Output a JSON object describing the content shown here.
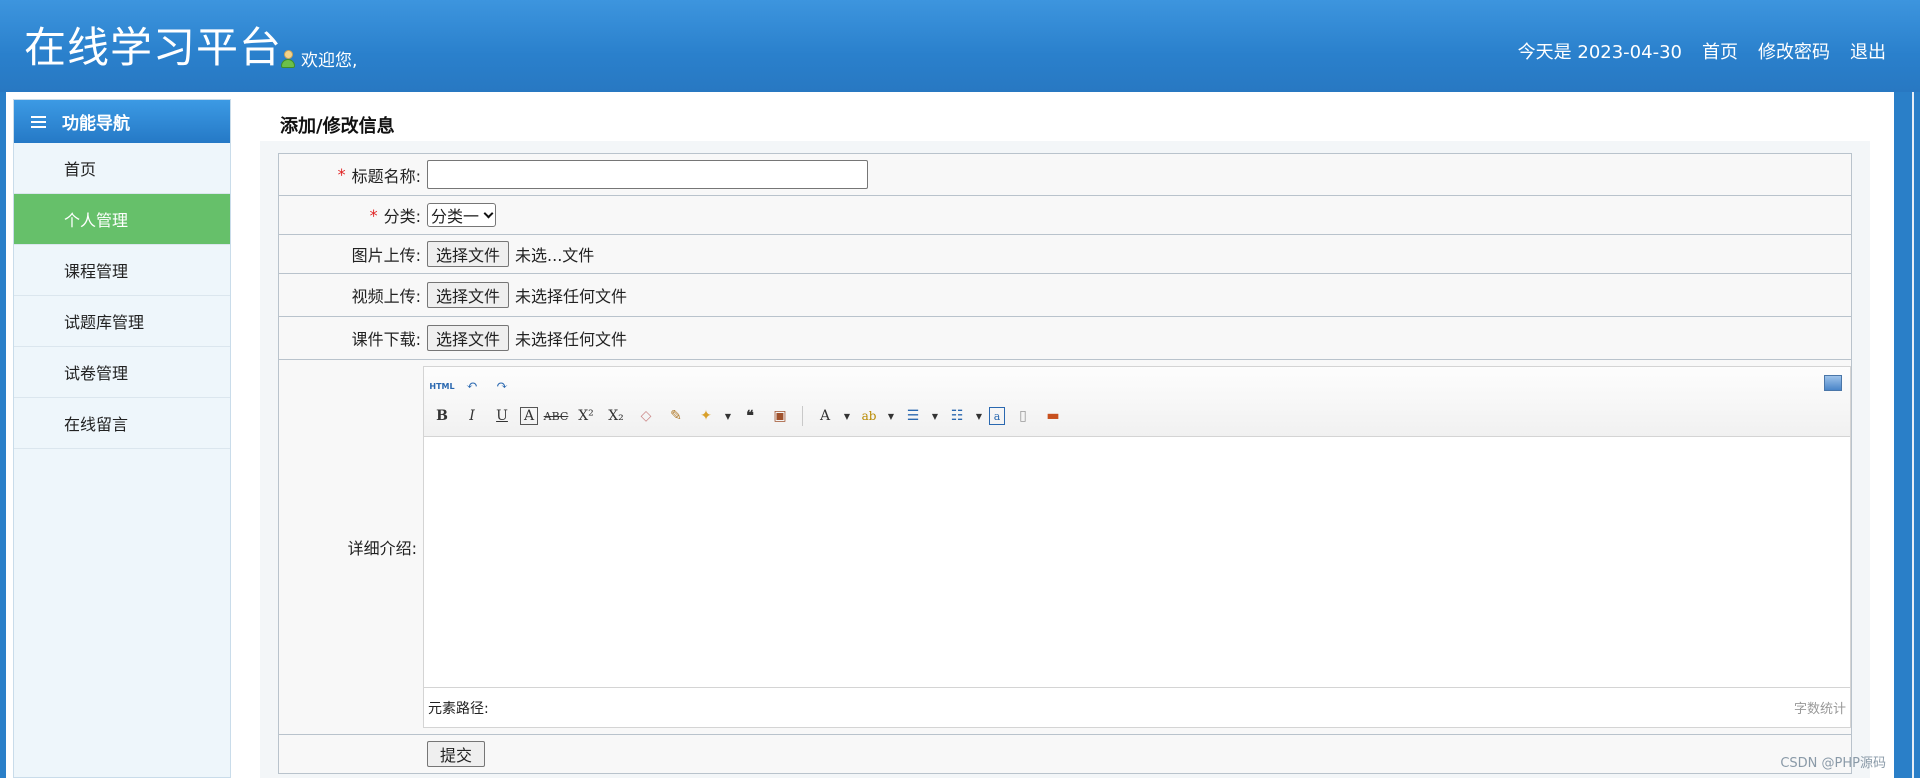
{
  "header": {
    "logo": "在线学习平台",
    "welcome": "欢迎您,",
    "date_text": "今天是 2023-04-30",
    "links": [
      "首页",
      "修改密码",
      "退出"
    ]
  },
  "sidebar": {
    "title": "功能导航",
    "items": [
      {
        "label": "首页",
        "active": false
      },
      {
        "label": "个人管理",
        "active": true
      },
      {
        "label": "课程管理",
        "active": false
      },
      {
        "label": "试题库管理",
        "active": false
      },
      {
        "label": "试卷管理",
        "active": false
      },
      {
        "label": "在线留言",
        "active": false
      }
    ]
  },
  "main": {
    "title": "添加/修改信息",
    "required_mark": "*",
    "fields": {
      "title_label": "标题名称:",
      "title_value": "",
      "category_label": "分类:",
      "category_value": "分类一",
      "image_label": "图片上传:",
      "image_button": "选择文件",
      "image_status": "未选...文件",
      "video_label": "视频上传:",
      "video_button": "选择文件",
      "video_status": "未选择任何文件",
      "courseware_label": "课件下载:",
      "courseware_button": "选择文件",
      "courseware_status": "未选择任何文件",
      "detail_label": "详细介绍:"
    },
    "editor": {
      "element_path": "元素路径:",
      "word_count": "字数统计",
      "html_btn": "HTML"
    },
    "submit": "提交"
  },
  "watermark": "CSDN @PHP源码",
  "colors": {
    "header_blue": "#2a80cc",
    "active_green": "#66c06a",
    "required_red": "#e02222"
  }
}
